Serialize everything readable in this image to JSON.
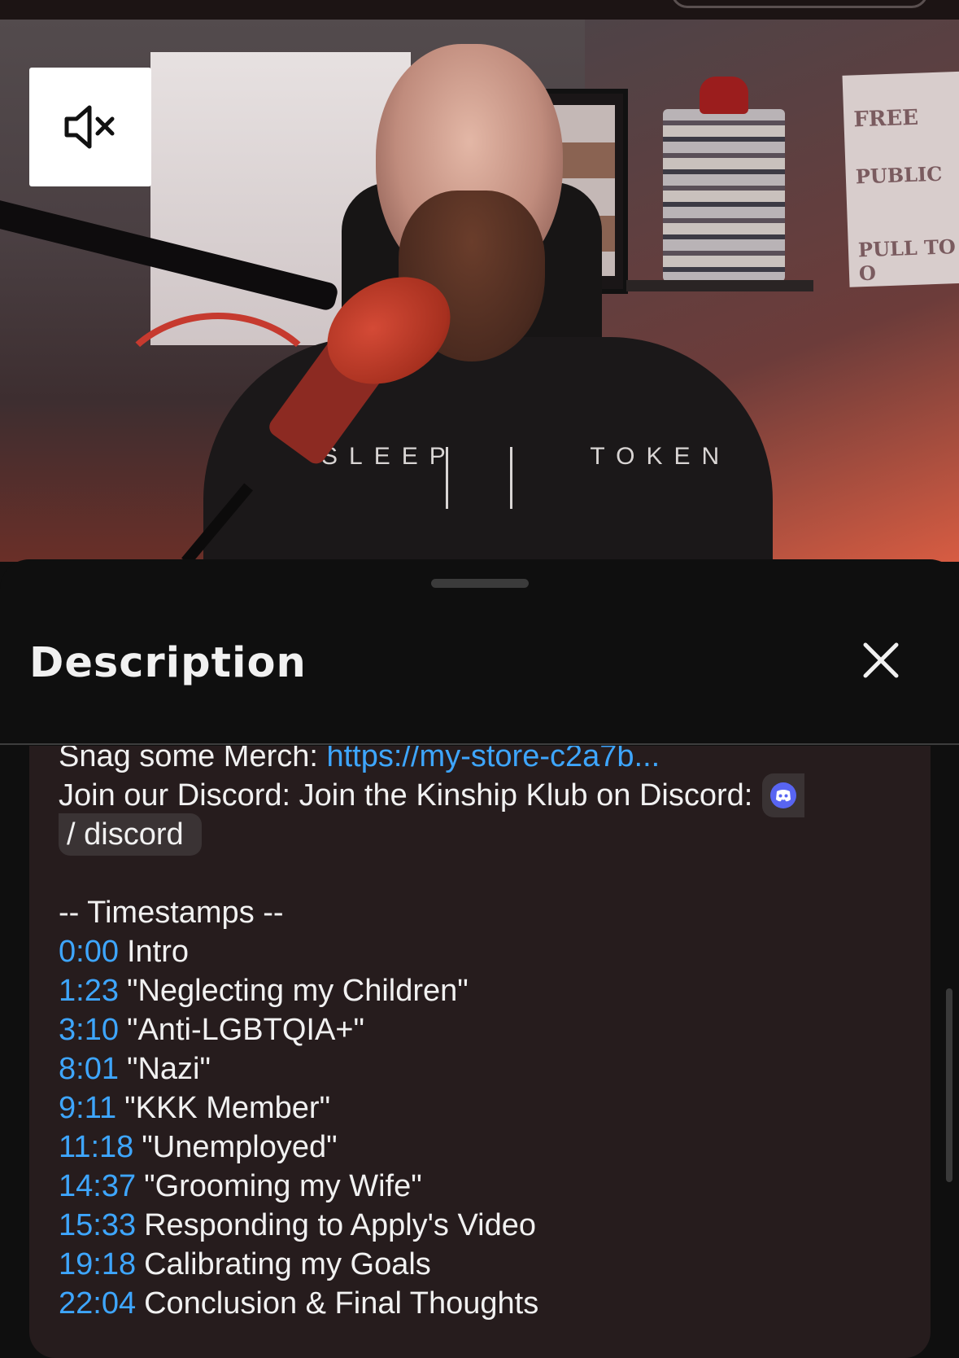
{
  "player": {
    "mute_button_icon": "volume-muted-icon",
    "shirt_text_left": "SLEEP",
    "shirt_text_right": "TOKEN",
    "poster_line1": "FREE",
    "poster_line2": "PUBLIC",
    "poster_line3": "PULL TO O"
  },
  "panel": {
    "title": "Description",
    "close_icon": "close-icon"
  },
  "description": {
    "merch_label": "Snag some Merch: ",
    "merch_link": "https://my-store-c2a7b...",
    "discord_label": "Join our Discord: Join the Kinship Klub on Discord:",
    "discord_chip_icon": "discord-icon",
    "discord_chip_text": "/ discord",
    "timestamps_header": "-- Timestamps --",
    "timestamps": [
      {
        "time": "0:00",
        "label": "Intro"
      },
      {
        "time": "1:23",
        "label": "\"Neglecting my Children\""
      },
      {
        "time": "3:10",
        "label": "\"Anti-LGBTQIA+\""
      },
      {
        "time": "8:01",
        "label": "\"Nazi\""
      },
      {
        "time": "9:11",
        "label": "\"KKK Member\""
      },
      {
        "time": "11:18",
        "label": "\"Unemployed\""
      },
      {
        "time": "14:37",
        "label": "\"Grooming my Wife\""
      },
      {
        "time": "15:33",
        "label": "Responding to Apply's Video"
      },
      {
        "time": "19:18",
        "label": "Calibrating my Goals"
      },
      {
        "time": "22:04",
        "label": "Conclusion & Final Thoughts"
      }
    ]
  },
  "colors": {
    "link": "#3ea6ff",
    "panel_bg": "#0f0f0f",
    "description_bg": "#261c1d",
    "text": "#f1f1f1",
    "discord_brand": "#5865f2"
  }
}
